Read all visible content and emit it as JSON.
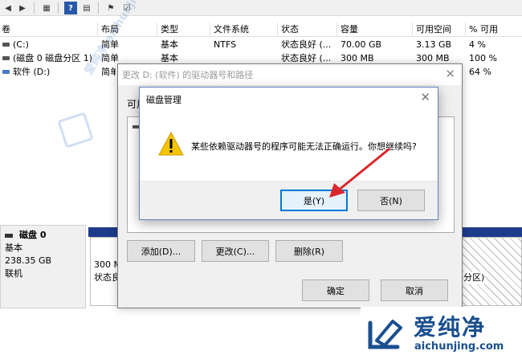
{
  "volume_table": {
    "headers": [
      "卷",
      "布局",
      "类型",
      "文件系统",
      "状态",
      "容量",
      "可用空间",
      "% 可用"
    ],
    "rows": [
      [
        "(C:)",
        "简单",
        "基本",
        "NTFS",
        "状态良好 (...",
        "70.00 GB",
        "3.13 GB",
        "4 %"
      ],
      [
        "(磁盘 0 磁盘分区 1)",
        "简单",
        "基本",
        "",
        "状态良好 (...",
        "300 MB",
        "300 MB",
        "100 %"
      ],
      [
        "软件 (D:)",
        "简单",
        "",
        "",
        "",
        "",
        "",
        "64 %"
      ]
    ]
  },
  "disk_panel": {
    "name": "磁盘 0",
    "type": "基本",
    "size": "238.35 GB",
    "status": "联机"
  },
  "partitions": {
    "p1_size": "300 M",
    "p1_status": "状态良",
    "p3_tail": "分区)"
  },
  "change_dialog": {
    "title": "更改 D: (软件) 的驱动器号和路径",
    "label": "可用",
    "add_button": "添加(D)...",
    "change_button": "更改(C)...",
    "delete_button": "删除(R)",
    "ok_button": "确定",
    "cancel_button": "取消"
  },
  "message_box": {
    "title": "磁盘管理",
    "message": "某些依赖驱动器号的程序可能无法正确运行。你想继续吗?",
    "yes_button": "是(Y)",
    "no_button": "否(N)"
  },
  "watermark": {
    "brand_cn": "爱纯净",
    "url": "aichunjing.com",
    "diag_text": "爱纯净 aichunjing"
  },
  "colors": {
    "arrow": "#d9262c",
    "warning": "#f5c400",
    "disk_bar": "#1e3c8c",
    "accent": "#0078d7"
  }
}
